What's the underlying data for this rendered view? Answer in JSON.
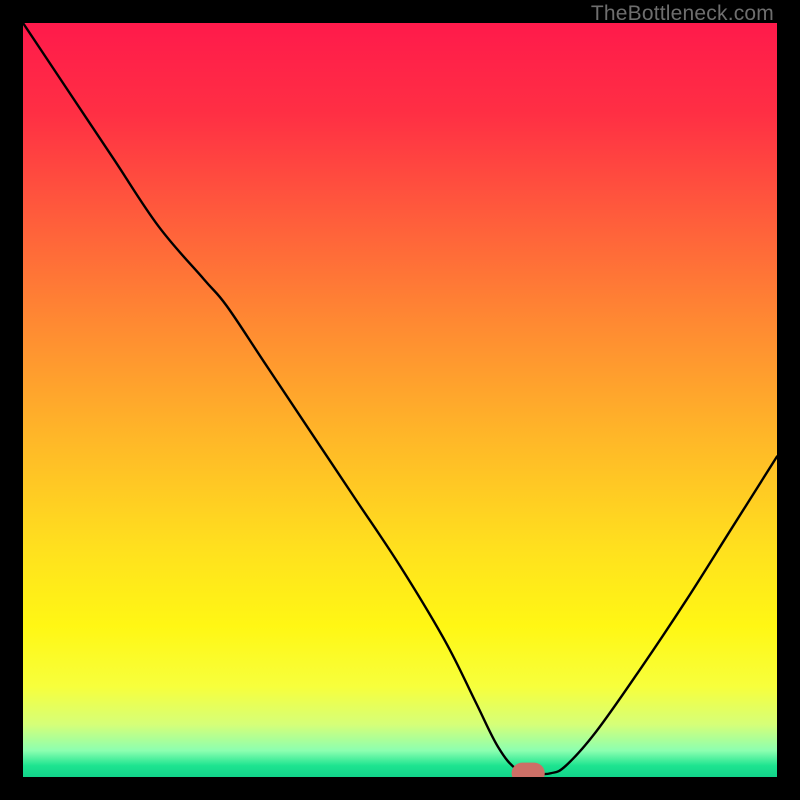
{
  "watermark": "TheBottleneck.com",
  "chart_data": {
    "type": "line",
    "title": "",
    "xlabel": "",
    "ylabel": "",
    "xlim": [
      0,
      100
    ],
    "ylim": [
      0,
      100
    ],
    "background": {
      "type": "vertical-gradient",
      "stops": [
        {
          "pct": 0.0,
          "color": "#ff1a4b"
        },
        {
          "pct": 0.12,
          "color": "#ff2f44"
        },
        {
          "pct": 0.25,
          "color": "#ff5a3c"
        },
        {
          "pct": 0.4,
          "color": "#ff8a32"
        },
        {
          "pct": 0.55,
          "color": "#ffb728"
        },
        {
          "pct": 0.7,
          "color": "#ffe11e"
        },
        {
          "pct": 0.8,
          "color": "#fff714"
        },
        {
          "pct": 0.88,
          "color": "#f7ff3c"
        },
        {
          "pct": 0.93,
          "color": "#d6ff78"
        },
        {
          "pct": 0.965,
          "color": "#8cffb0"
        },
        {
          "pct": 0.985,
          "color": "#1de490"
        },
        {
          "pct": 1.0,
          "color": "#12d38a"
        }
      ]
    },
    "series": [
      {
        "name": "bottleneck-curve",
        "color": "#000000",
        "width": 2.4,
        "x": [
          0.0,
          6.0,
          12.0,
          18.0,
          24.0,
          27.0,
          32.0,
          38.0,
          44.0,
          50.0,
          56.0,
          60.0,
          63.0,
          65.5,
          68.0,
          70.0,
          72.0,
          76.0,
          82.0,
          88.0,
          94.0,
          100.0
        ],
        "y": [
          100.0,
          91.0,
          82.0,
          73.0,
          66.0,
          62.5,
          55.0,
          46.0,
          37.0,
          28.0,
          18.0,
          10.0,
          4.0,
          1.0,
          0.5,
          0.5,
          1.5,
          6.0,
          14.5,
          23.5,
          33.0,
          42.5
        ]
      }
    ],
    "marker": {
      "name": "optimal-point",
      "x": 67.0,
      "y": 0.5,
      "rx": 2.2,
      "ry": 1.4,
      "color": "#cc6f66"
    }
  }
}
